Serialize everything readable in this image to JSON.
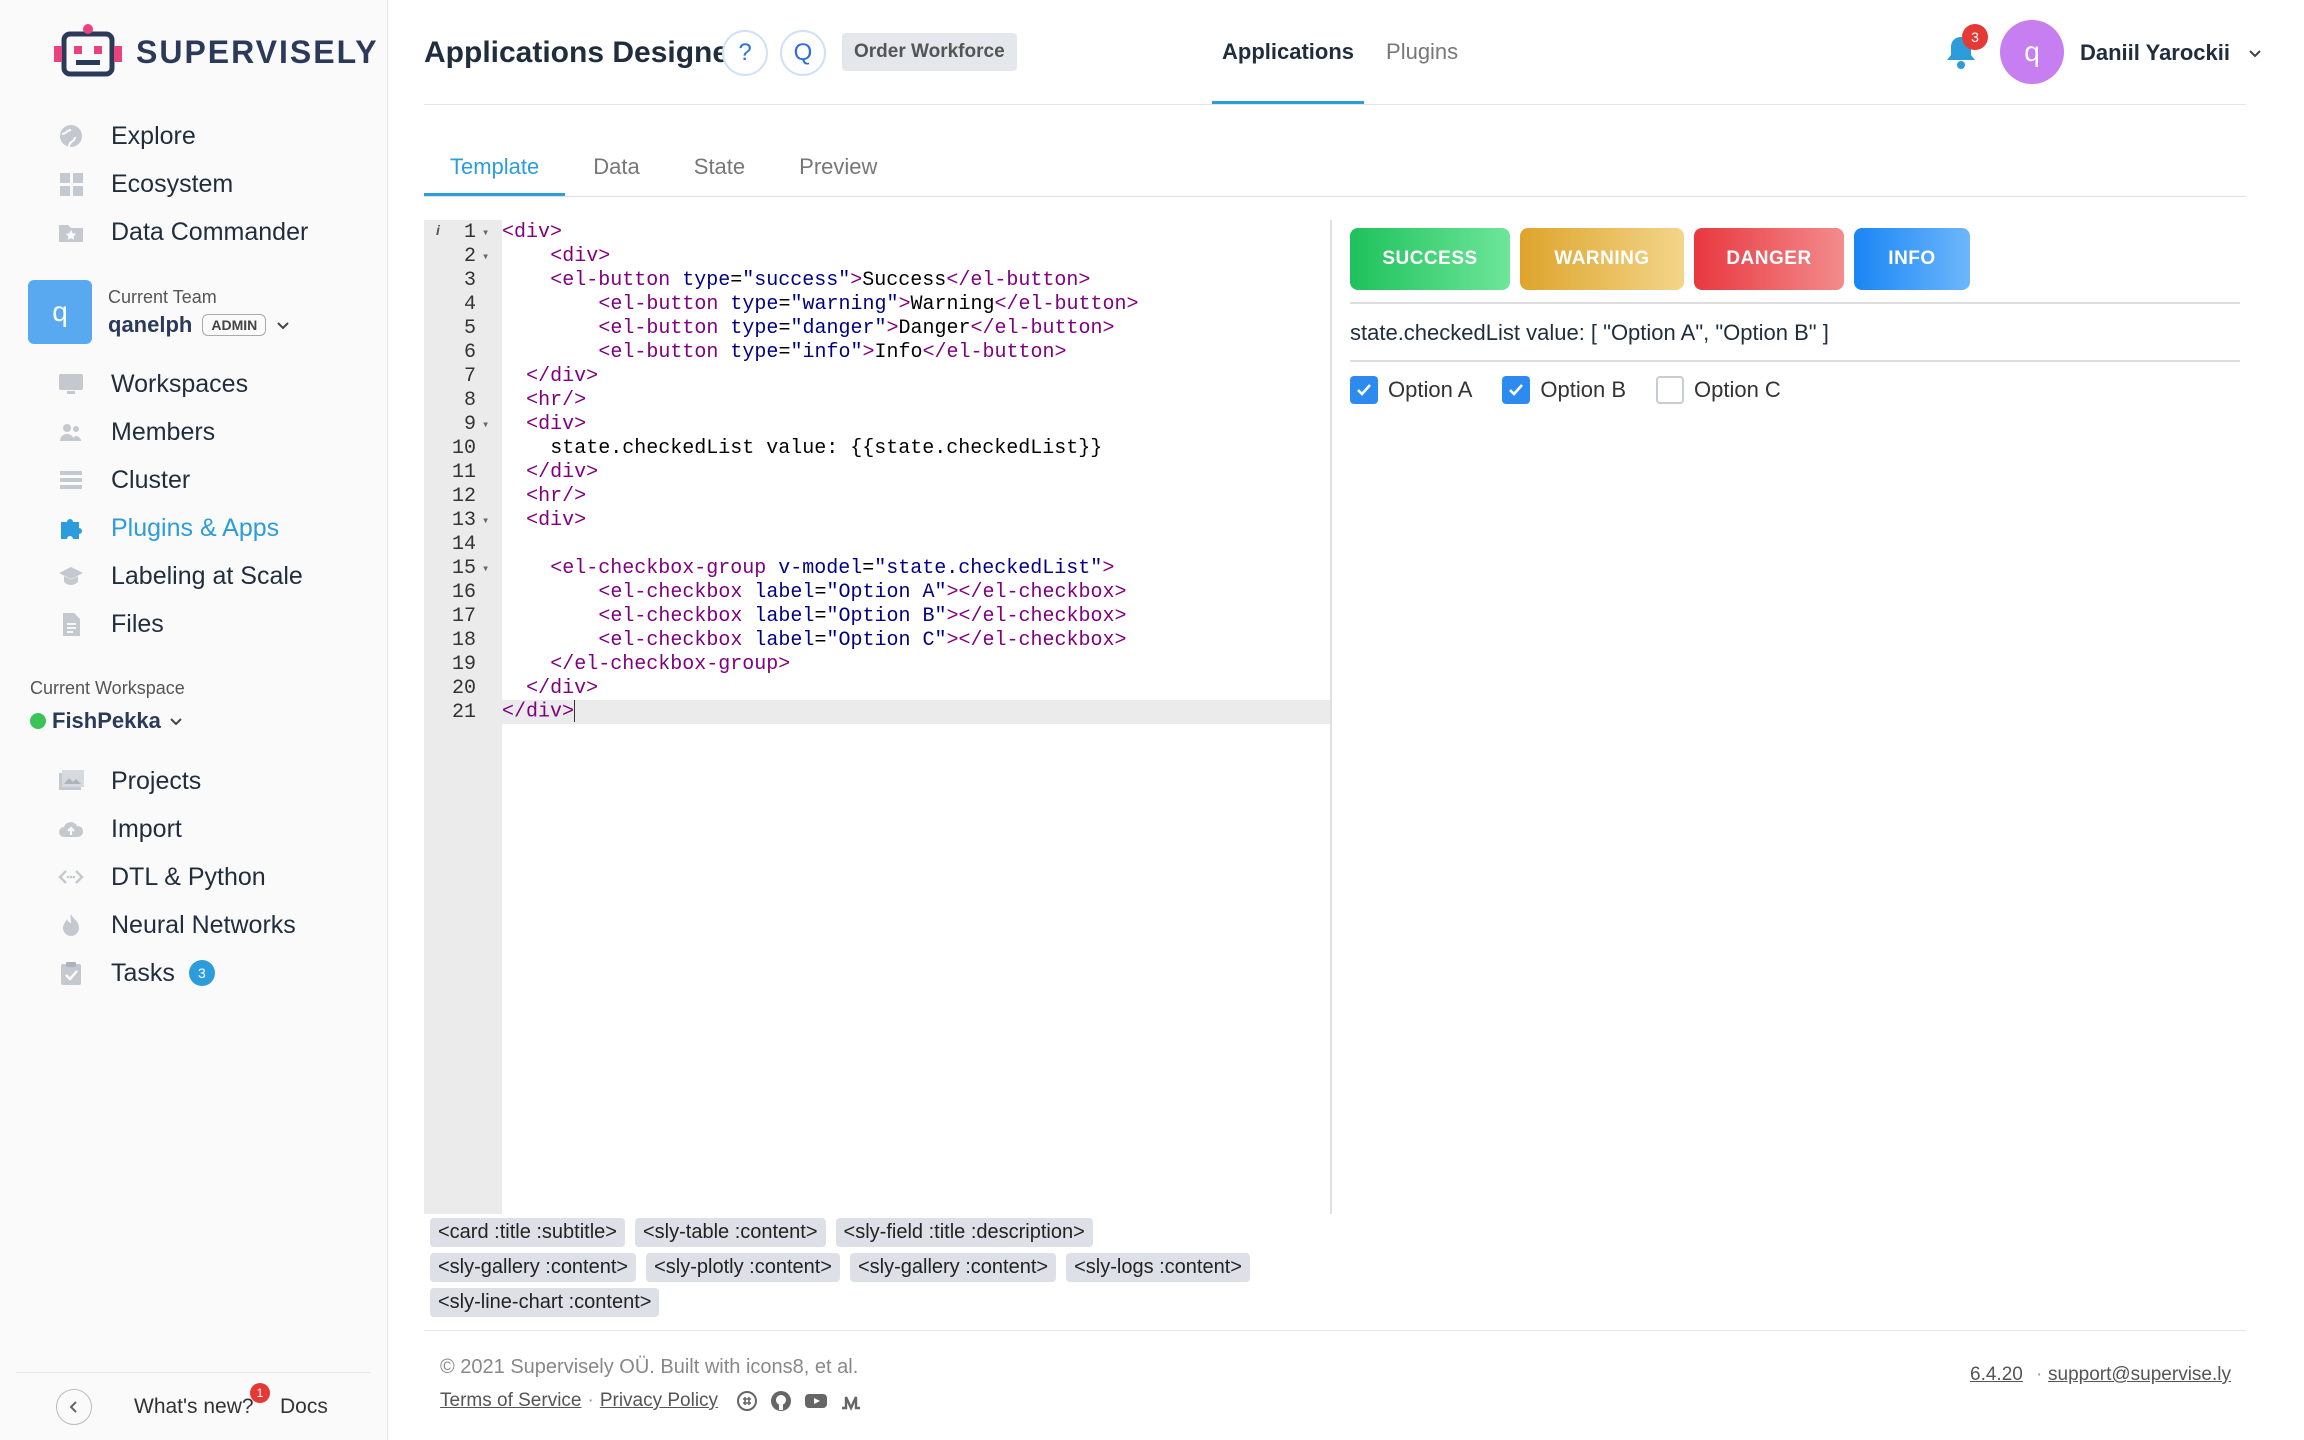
{
  "brand": {
    "name": "SUPERVISELY",
    "logo_icon": "robot-icon"
  },
  "nav_top": [
    {
      "label": "Explore",
      "icon": "globe-icon"
    },
    {
      "label": "Ecosystem",
      "icon": "grid-icon"
    },
    {
      "label": "Data Commander",
      "icon": "folder-star-icon"
    }
  ],
  "team": {
    "label": "Current Team",
    "avatar": "q",
    "name": "qanelph",
    "role": "ADMIN"
  },
  "nav_team": [
    {
      "label": "Workspaces",
      "icon": "monitor-icon"
    },
    {
      "label": "Members",
      "icon": "people-icon"
    },
    {
      "label": "Cluster",
      "icon": "list-icon"
    },
    {
      "label": "Plugins & Apps",
      "icon": "puzzle-icon",
      "active": true
    },
    {
      "label": "Labeling at Scale",
      "icon": "graduation-icon"
    },
    {
      "label": "Files",
      "icon": "file-icon"
    }
  ],
  "workspace": {
    "label": "Current Workspace",
    "name": "FishPekka",
    "status_color": "#3ac356"
  },
  "nav_ws": [
    {
      "label": "Projects",
      "icon": "images-icon"
    },
    {
      "label": "Import",
      "icon": "cloud-upload-icon"
    },
    {
      "label": "DTL & Python",
      "icon": "code-icon"
    },
    {
      "label": "Neural Networks",
      "icon": "flame-icon"
    },
    {
      "label": "Tasks",
      "icon": "clipboard-check-icon",
      "count": "3"
    }
  ],
  "sidebar_bottom": {
    "whats_new": "What's new?",
    "whats_new_count": "1",
    "docs": "Docs"
  },
  "header": {
    "title": "Applications Designer",
    "help_btn": "?",
    "search_btn": "Q",
    "tag": "Order Workforce",
    "tabs": [
      {
        "label": "Applications",
        "active": true
      },
      {
        "label": "Plugins"
      }
    ],
    "notifications": "3",
    "user_avatar": "q",
    "user_name": "Daniil Yarockii"
  },
  "sub_tabs": [
    {
      "label": "Template",
      "active": true
    },
    {
      "label": "Data"
    },
    {
      "label": "State"
    },
    {
      "label": "Preview"
    }
  ],
  "editor": {
    "info_marker": "i",
    "lines": [
      {
        "n": "1",
        "fold": true,
        "indent": 0,
        "parts": [
          [
            "tg",
            "<div>"
          ]
        ]
      },
      {
        "n": "2",
        "fold": true,
        "indent": 4,
        "parts": [
          [
            "tg",
            "<div>"
          ]
        ]
      },
      {
        "n": "3",
        "indent": 4,
        "parts": [
          [
            "tg",
            "<el-button "
          ],
          [
            "at",
            "type"
          ],
          [
            "txt",
            "="
          ],
          [
            "st",
            "\"success\""
          ],
          [
            "tg",
            ">"
          ],
          [
            "txt",
            "Success"
          ],
          [
            "tg",
            "</el-button>"
          ]
        ]
      },
      {
        "n": "4",
        "indent": 8,
        "parts": [
          [
            "tg",
            "<el-button "
          ],
          [
            "at",
            "type"
          ],
          [
            "txt",
            "="
          ],
          [
            "st",
            "\"warning\""
          ],
          [
            "tg",
            ">"
          ],
          [
            "txt",
            "Warning"
          ],
          [
            "tg",
            "</el-button>"
          ]
        ]
      },
      {
        "n": "5",
        "indent": 8,
        "parts": [
          [
            "tg",
            "<el-button "
          ],
          [
            "at",
            "type"
          ],
          [
            "txt",
            "="
          ],
          [
            "st",
            "\"danger\""
          ],
          [
            "tg",
            ">"
          ],
          [
            "txt",
            "Danger"
          ],
          [
            "tg",
            "</el-button>"
          ]
        ]
      },
      {
        "n": "6",
        "indent": 8,
        "parts": [
          [
            "tg",
            "<el-button "
          ],
          [
            "at",
            "type"
          ],
          [
            "txt",
            "="
          ],
          [
            "st",
            "\"info\""
          ],
          [
            "tg",
            ">"
          ],
          [
            "txt",
            "Info"
          ],
          [
            "tg",
            "</el-button>"
          ]
        ]
      },
      {
        "n": "7",
        "indent": 2,
        "parts": [
          [
            "tg",
            "</div>"
          ]
        ]
      },
      {
        "n": "8",
        "indent": 2,
        "parts": [
          [
            "tg",
            "<hr/>"
          ]
        ]
      },
      {
        "n": "9",
        "fold": true,
        "indent": 2,
        "parts": [
          [
            "tg",
            "<div>"
          ]
        ]
      },
      {
        "n": "10",
        "indent": 4,
        "parts": [
          [
            "txt",
            "state.checkedList value: {{state.checkedList}}"
          ]
        ]
      },
      {
        "n": "11",
        "indent": 2,
        "parts": [
          [
            "tg",
            "</div>"
          ]
        ]
      },
      {
        "n": "12",
        "indent": 2,
        "parts": [
          [
            "tg",
            "<hr/>"
          ]
        ]
      },
      {
        "n": "13",
        "fold": true,
        "indent": 2,
        "parts": [
          [
            "tg",
            "<div>"
          ]
        ]
      },
      {
        "n": "14",
        "indent": 0,
        "parts": []
      },
      {
        "n": "15",
        "fold": true,
        "indent": 4,
        "parts": [
          [
            "tg",
            "<el-checkbox-group "
          ],
          [
            "at",
            "v-model"
          ],
          [
            "txt",
            "="
          ],
          [
            "st",
            "\"state.checkedList\""
          ],
          [
            "tg",
            ">"
          ]
        ]
      },
      {
        "n": "16",
        "indent": 8,
        "parts": [
          [
            "tg",
            "<el-checkbox "
          ],
          [
            "at",
            "label"
          ],
          [
            "txt",
            "="
          ],
          [
            "st",
            "\"Option A\""
          ],
          [
            "tg",
            "></el-checkbox>"
          ]
        ]
      },
      {
        "n": "17",
        "indent": 8,
        "parts": [
          [
            "tg",
            "<el-checkbox "
          ],
          [
            "at",
            "label"
          ],
          [
            "txt",
            "="
          ],
          [
            "st",
            "\"Option B\""
          ],
          [
            "tg",
            "></el-checkbox>"
          ]
        ]
      },
      {
        "n": "18",
        "indent": 8,
        "parts": [
          [
            "tg",
            "<el-checkbox "
          ],
          [
            "at",
            "label"
          ],
          [
            "txt",
            "="
          ],
          [
            "st",
            "\"Option C\""
          ],
          [
            "tg",
            "></el-checkbox>"
          ]
        ]
      },
      {
        "n": "19",
        "indent": 4,
        "parts": [
          [
            "tg",
            "</el-checkbox-group>"
          ]
        ]
      },
      {
        "n": "20",
        "indent": 2,
        "parts": [
          [
            "tg",
            "</div>"
          ]
        ]
      },
      {
        "n": "21",
        "indent": 0,
        "current": true,
        "parts": [
          [
            "tg",
            "</div>"
          ]
        ]
      }
    ]
  },
  "snippets": [
    "<card :title :subtitle>",
    "<sly-table :content>",
    "<sly-field :title :description>",
    "<sly-gallery :content>",
    "<sly-plotly :content>",
    "<sly-gallery :content>",
    "<sly-logs :content>",
    "<sly-line-chart :content>"
  ],
  "preview": {
    "buttons": [
      {
        "label": "SUCCESS",
        "kind": "success"
      },
      {
        "label": "WARNING",
        "kind": "warning"
      },
      {
        "label": "DANGER",
        "kind": "danger"
      },
      {
        "label": "INFO",
        "kind": "info"
      }
    ],
    "state_text": "state.checkedList value: [ \"Option A\", \"Option B\" ]",
    "checkboxes": [
      {
        "label": "Option A",
        "checked": true
      },
      {
        "label": "Option B",
        "checked": true
      },
      {
        "label": "Option C",
        "checked": false
      }
    ]
  },
  "footer": {
    "copyright": "© 2021 Supervisely OÜ. Built with icons8, et al.",
    "terms": "Terms of Service",
    "privacy": "Privacy Policy",
    "social": [
      "slack-icon",
      "github-icon",
      "youtube-icon",
      "medium-icon"
    ],
    "version": "6.4.20",
    "support": "support@supervise.ly"
  }
}
